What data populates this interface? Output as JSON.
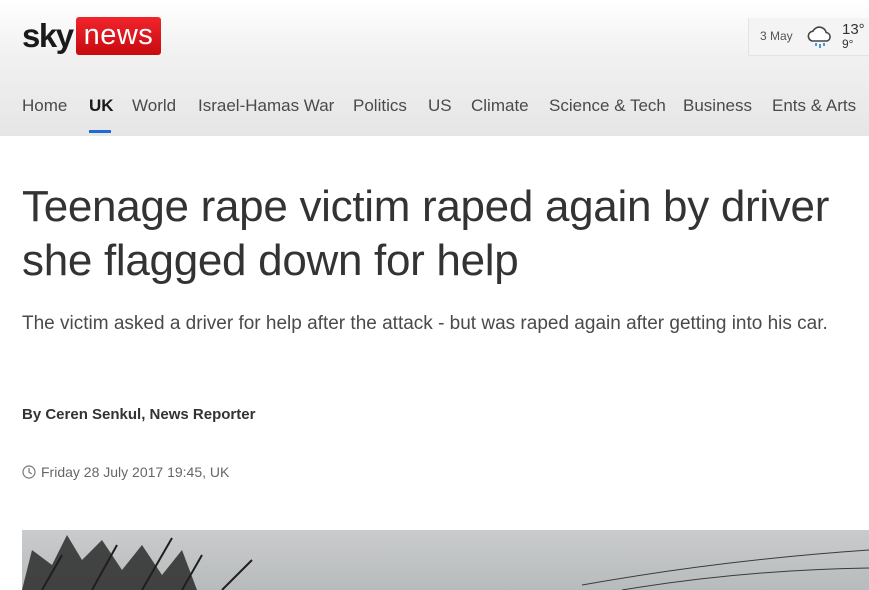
{
  "brand": {
    "sky": "sky",
    "news": "news"
  },
  "weather": {
    "date": "3 May",
    "high": "13°",
    "low": "9°",
    "icon": "rain-cloud-icon"
  },
  "nav": {
    "items": [
      {
        "label": "Home"
      },
      {
        "label": "UK",
        "active": true
      },
      {
        "label": "World"
      },
      {
        "label": "Israel-Hamas War"
      },
      {
        "label": "Politics"
      },
      {
        "label": "US"
      },
      {
        "label": "Climate"
      },
      {
        "label": "Science & Tech"
      },
      {
        "label": "Business"
      },
      {
        "label": "Ents & Arts"
      }
    ]
  },
  "article": {
    "headline": "Teenage rape victim raped again by driver she flagged down for help",
    "standfirst": "The victim asked a driver for help after the attack - but was raped again after getting into his car.",
    "byline": "By Ceren Senkul, News Reporter",
    "timestamp": "Friday 28 July 2017 19:45, UK"
  },
  "colors": {
    "brand_red": "#e10a14",
    "nav_active_underline": "#1f6bd3"
  }
}
